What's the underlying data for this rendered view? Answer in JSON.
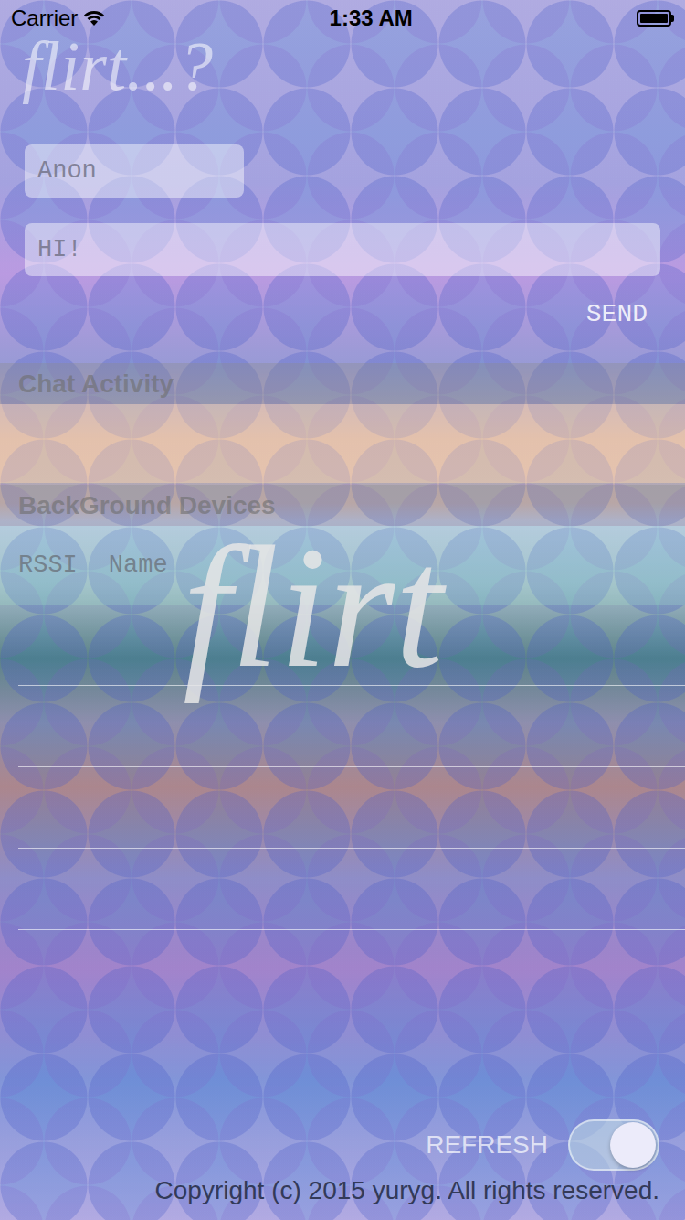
{
  "status_bar": {
    "carrier": "Carrier",
    "time": "1:33 AM",
    "battery_level": 1
  },
  "logo": "flirt...?",
  "name_field": {
    "placeholder": "Anon"
  },
  "message_field": {
    "placeholder": "HI!"
  },
  "send_button": "SEND",
  "chat_section": {
    "title": "Chat Activity"
  },
  "devices_section": {
    "title": "BackGround Devices",
    "columns": [
      "RSSI",
      "Name"
    ]
  },
  "watermark": "flirt",
  "refresh_button": "REFRESH",
  "refresh_toggle": {
    "on": true
  },
  "copyright": "Copyright (c) 2015 yuryg. All rights reserved."
}
